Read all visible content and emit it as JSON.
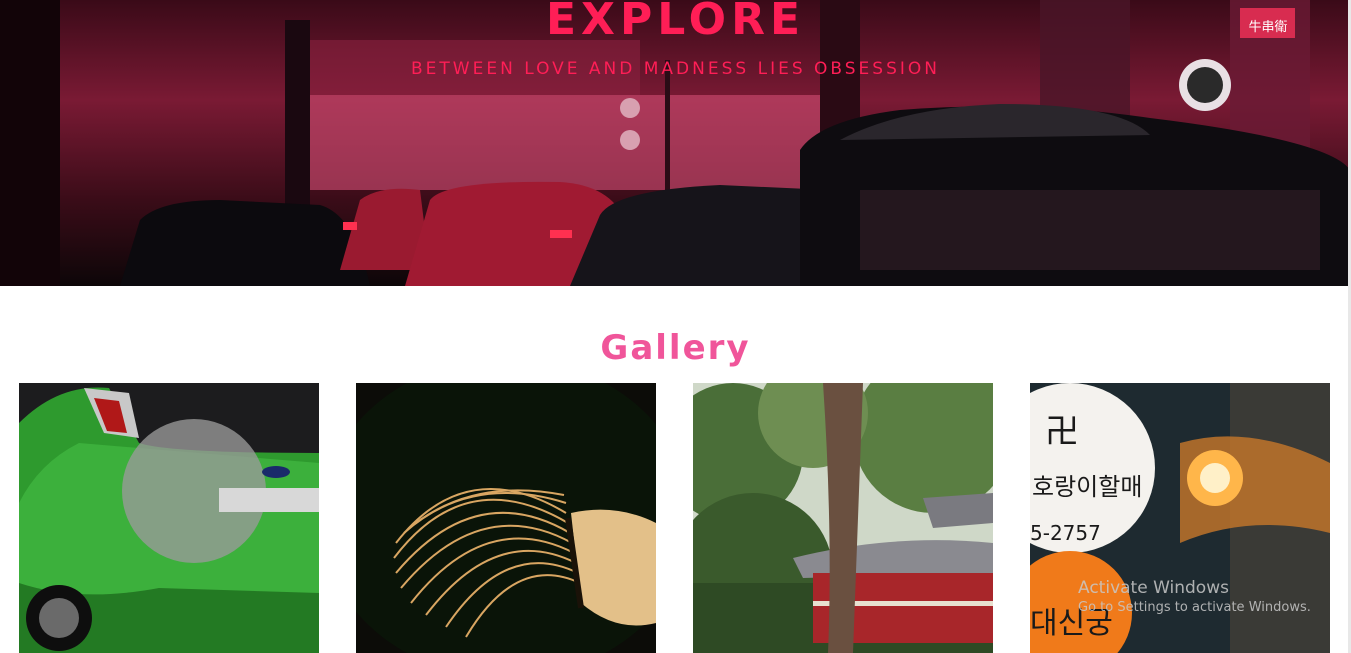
{
  "hero": {
    "title": "EXPLORE",
    "subtitle": "BETWEEN LOVE AND MADNESS LIES OBSESSION",
    "accent_color": "#ff1e56",
    "sign_text": "牛串衛"
  },
  "gallery": {
    "title": "Gallery",
    "title_color": "#f0559a",
    "items": [
      {
        "subject": "green-car-rear"
      },
      {
        "subject": "matcha-whisk"
      },
      {
        "subject": "temple-with-tree"
      },
      {
        "subject": "korean-street-signs",
        "sign_lines": [
          "卍",
          "호랑이할매",
          "5-2757",
          "대신궁"
        ]
      }
    ]
  },
  "watermark": {
    "line1": "Activate Windows",
    "line2": "Go to Settings to activate Windows."
  }
}
